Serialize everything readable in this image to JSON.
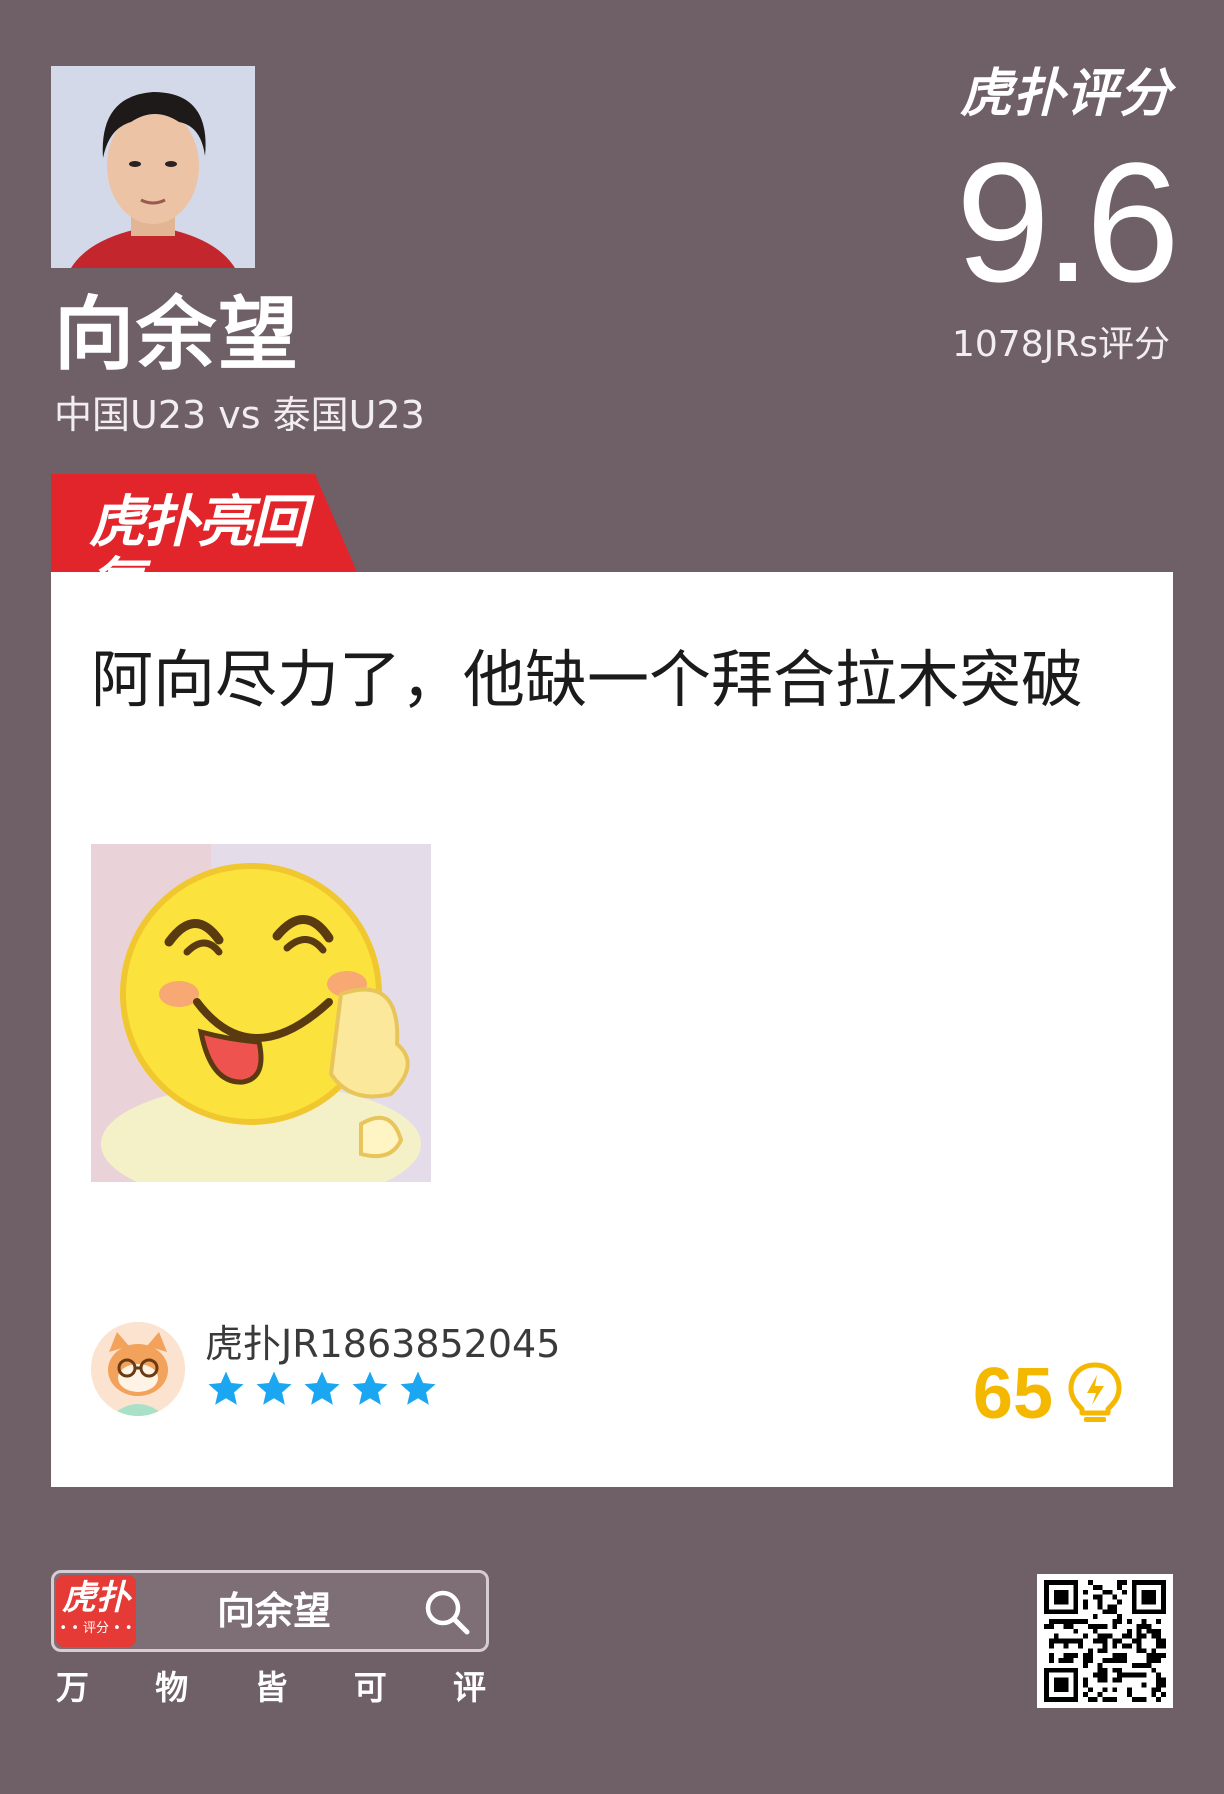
{
  "player": {
    "name": "向余望",
    "match": "中国U23 vs 泰国U23"
  },
  "rating": {
    "brand": "虎扑评分",
    "score": "9.6",
    "count_label": "1078JRs评分"
  },
  "reply_tag": {
    "label": "虎扑亮回复"
  },
  "comment": {
    "text": "阿向尽力了，他缺一个拜合拉木突破",
    "meme_icon": "smiling-tongue-thumbs-up-emoji",
    "user": {
      "name": "虎扑JR1863852045",
      "stars": 5,
      "star_color": "#1aa6f0"
    },
    "likes": "65",
    "like_color": "#f5b800"
  },
  "footer": {
    "app_icon_top": "虎扑",
    "app_icon_bottom": "• • 评分 • •",
    "search_text": "向余望",
    "slogan": [
      "万",
      "物",
      "皆",
      "可",
      "评"
    ]
  },
  "colors": {
    "background": "#6f5f67",
    "reply_tag": "#e1252b"
  }
}
